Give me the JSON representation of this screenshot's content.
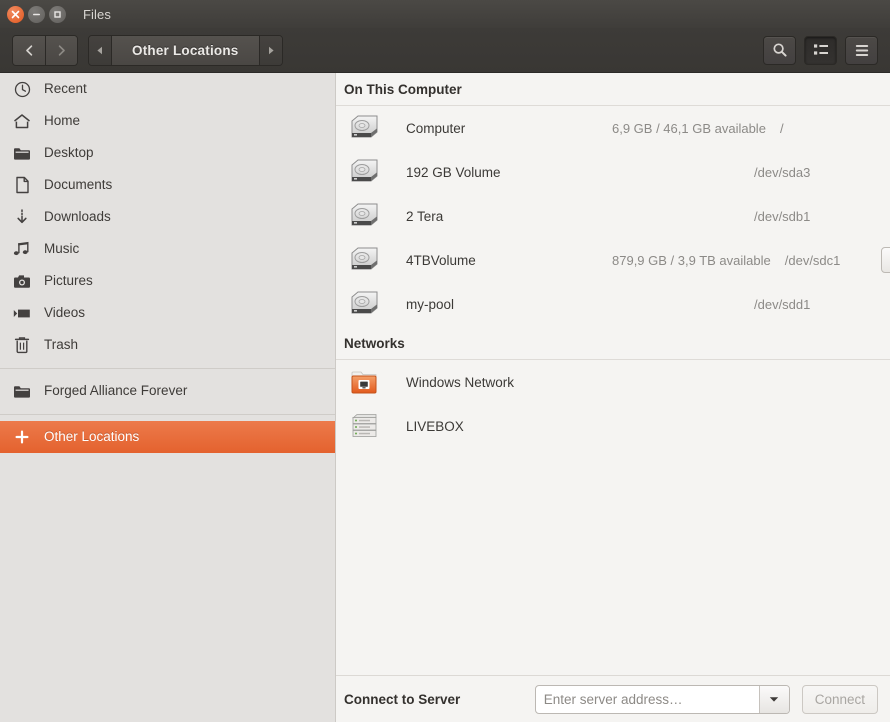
{
  "window": {
    "title": "Files",
    "controls": [
      {
        "name": "close",
        "glyph": "×"
      },
      {
        "name": "minimize",
        "glyph": "−"
      },
      {
        "name": "maximize",
        "glyph": "□"
      }
    ]
  },
  "toolbar": {
    "back_label": "Back",
    "forward_label": "Forward",
    "path_prev_label": "Previous path",
    "path_next_label": "Next path",
    "current_location": "Other Locations",
    "search_label": "Search",
    "view_toggle_label": "List view",
    "menu_label": "Menu"
  },
  "sidebar": {
    "items": [
      {
        "label": "Recent",
        "icon": "clock-icon",
        "selected": false
      },
      {
        "label": "Home",
        "icon": "home-icon",
        "selected": false
      },
      {
        "label": "Desktop",
        "icon": "folder-icon",
        "selected": false
      },
      {
        "label": "Documents",
        "icon": "document-icon",
        "selected": false
      },
      {
        "label": "Downloads",
        "icon": "download-icon",
        "selected": false
      },
      {
        "label": "Music",
        "icon": "music-icon",
        "selected": false
      },
      {
        "label": "Pictures",
        "icon": "camera-icon",
        "selected": false
      },
      {
        "label": "Videos",
        "icon": "video-icon",
        "selected": false
      },
      {
        "label": "Trash",
        "icon": "trash-icon",
        "selected": false
      }
    ],
    "bookmarks": [
      {
        "label": "Forged Alliance Forever",
        "icon": "folder-icon",
        "selected": false
      }
    ],
    "other": {
      "label": "Other Locations",
      "icon": "plus-icon",
      "selected": true
    },
    "selected_color": "#e4622e"
  },
  "main": {
    "groups": [
      {
        "title": "On This Computer",
        "rows": [
          {
            "name": "Computer",
            "free": "6,9 GB / 46,1 GB available",
            "device": "/",
            "icon": "hard-drive-icon",
            "eject": false
          },
          {
            "name": "192 GB Volume",
            "free": "",
            "device": "/dev/sda3",
            "icon": "hard-drive-icon",
            "eject": false
          },
          {
            "name": "2 Tera",
            "free": "",
            "device": "/dev/sdb1",
            "icon": "hard-drive-icon",
            "eject": false
          },
          {
            "name": "4TBVolume",
            "free": "879,9 GB / 3,9 TB available",
            "device": "/dev/sdc1",
            "icon": "hard-drive-icon",
            "eject": true
          },
          {
            "name": "my-pool",
            "free": "",
            "device": "/dev/sdd1",
            "icon": "hard-drive-icon",
            "eject": false
          }
        ]
      },
      {
        "title": "Networks",
        "rows": [
          {
            "name": "Windows Network",
            "free": "",
            "device": "",
            "icon": "network-folder-icon",
            "eject": false
          },
          {
            "name": "LIVEBOX",
            "free": "",
            "device": "",
            "icon": "server-icon",
            "eject": false
          }
        ]
      }
    ]
  },
  "bottom": {
    "label": "Connect to Server",
    "input_value": "",
    "input_placeholder": "Enter server address…",
    "dropdown_label": "Recent servers",
    "connect_label": "Connect"
  }
}
